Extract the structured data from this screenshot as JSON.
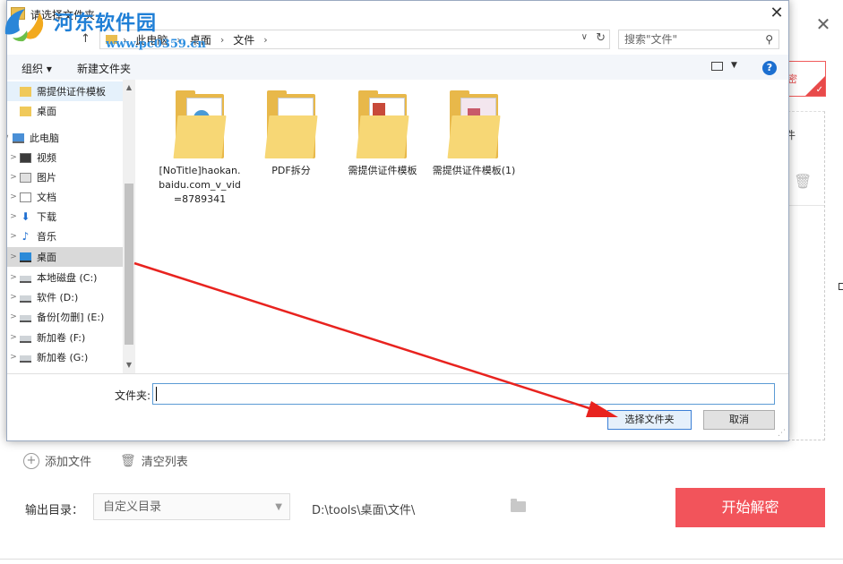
{
  "watermark": {
    "title": "河东软件园",
    "url": "www.pc0359.cn"
  },
  "app": {
    "close_glyph": "✕",
    "red_button_label": "密",
    "right_column_label": "件",
    "add_file_label": "添加文件",
    "clear_list_label": "清空列表",
    "output_label": "输出目录：",
    "output_select_value": "自定义目录",
    "output_path": "D:\\tools\\桌面\\文件\\",
    "start_button_label": "开始解密"
  },
  "dialog": {
    "title": "请选择文件夹",
    "close_glyph": "✕",
    "breadcrumbs": [
      "此电脑",
      "桌面",
      "文件"
    ],
    "search_placeholder": "搜索\"文件\"",
    "toolbar": {
      "organize": "组织 ▾",
      "new_folder": "新建文件夹",
      "help": "?"
    },
    "tree": [
      {
        "label": "需提供证件模板",
        "icon": "folder-icon",
        "chevron": ""
      },
      {
        "label": "桌面",
        "icon": "folder-icon",
        "chevron": ""
      },
      {
        "label": "此电脑",
        "icon": "computer-icon",
        "chevron": "∨"
      },
      {
        "label": "视频",
        "icon": "video-icon",
        "chevron": ">"
      },
      {
        "label": "图片",
        "icon": "pictures-icon",
        "chevron": ">"
      },
      {
        "label": "文档",
        "icon": "documents-icon",
        "chevron": ">"
      },
      {
        "label": "下载",
        "icon": "download-icon",
        "chevron": ">"
      },
      {
        "label": "音乐",
        "icon": "music-icon",
        "chevron": ">"
      },
      {
        "label": "桌面",
        "icon": "desktop-icon",
        "chevron": ">"
      },
      {
        "label": "本地磁盘 (C:)",
        "icon": "system-drive-icon",
        "chevron": ">"
      },
      {
        "label": "软件 (D:)",
        "icon": "drive-icon",
        "chevron": ">"
      },
      {
        "label": "备份[勿删] (E:)",
        "icon": "drive-icon",
        "chevron": ">"
      },
      {
        "label": "新加卷 (F:)",
        "icon": "drive-icon",
        "chevron": ">"
      },
      {
        "label": "新加卷 (G:)",
        "icon": "drive-icon",
        "chevron": ">"
      }
    ],
    "files": [
      {
        "label": "[NoTitle]haokan.baidu.com_v_vid=8789341"
      },
      {
        "label": "PDF拆分"
      },
      {
        "label": "需提供证件模板"
      },
      {
        "label": "需提供证件模板(1)"
      }
    ],
    "folder_label": "文件夹:",
    "folder_value": "",
    "select_button": "选择文件夹",
    "cancel_button": "取消"
  },
  "colors": {
    "accent_red": "#f2545b",
    "arrow_red": "#e8231f",
    "watermark_blue": "#1f7fd6",
    "selection_blue": "#3c7fd6"
  }
}
